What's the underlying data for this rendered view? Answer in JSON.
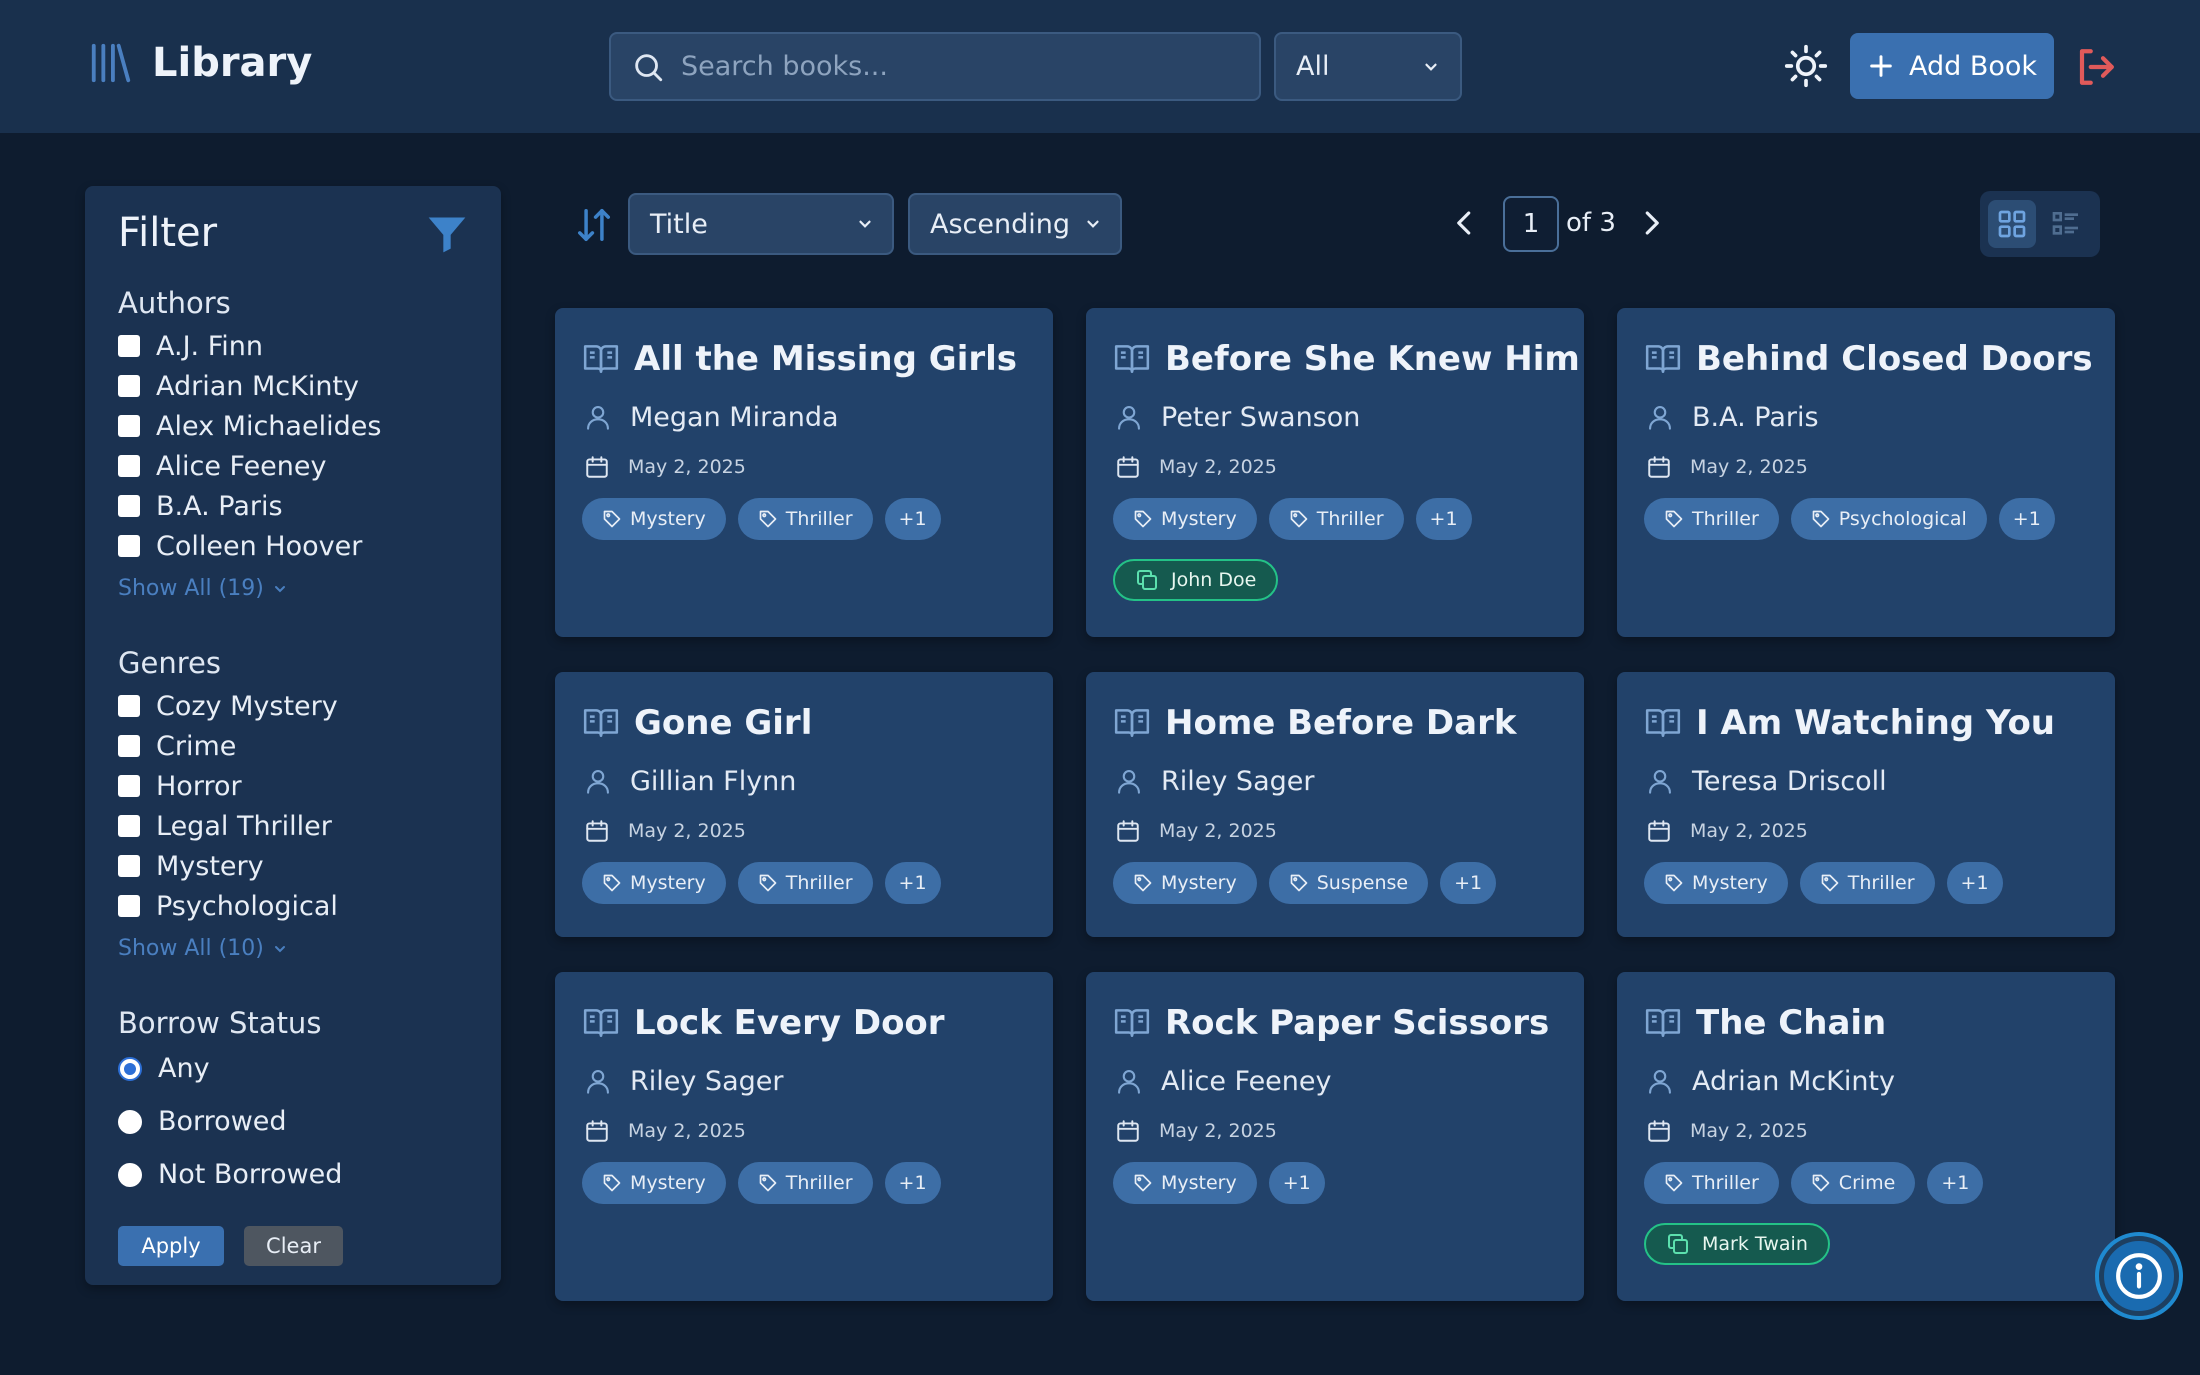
{
  "header": {
    "title": "Library",
    "search_placeholder": "Search books...",
    "scope": "All",
    "add_label": "Add Book"
  },
  "toolbar": {
    "sort_field": "Title",
    "sort_order": "Ascending",
    "page": "1",
    "of_label": "of 3"
  },
  "sidebar": {
    "title": "Filter",
    "authors_title": "Authors",
    "authors": [
      "A.J. Finn",
      "Adrian McKinty",
      "Alex Michaelides",
      "Alice Feeney",
      "B.A. Paris",
      "Colleen Hoover"
    ],
    "authors_show_all": "Show All (19)",
    "genres_title": "Genres",
    "genres": [
      "Cozy Mystery",
      "Crime",
      "Horror",
      "Legal Thriller",
      "Mystery",
      "Psychological"
    ],
    "genres_show_all": "Show All (10)",
    "borrow_title": "Borrow Status",
    "borrow_options": [
      "Any",
      "Borrowed",
      "Not Borrowed"
    ],
    "apply_label": "Apply",
    "clear_label": "Clear"
  },
  "books": [
    {
      "title": "All the Missing Girls",
      "author": "Megan Miranda",
      "date": "May 2, 2025",
      "tags": [
        "Mystery",
        "Thriller"
      ],
      "more": "+1",
      "borrower": ""
    },
    {
      "title": "Before She Knew Him",
      "author": "Peter Swanson",
      "date": "May 2, 2025",
      "tags": [
        "Mystery",
        "Thriller"
      ],
      "more": "+1",
      "borrower": "John Doe"
    },
    {
      "title": "Behind Closed Doors",
      "author": "B.A. Paris",
      "date": "May 2, 2025",
      "tags": [
        "Thriller",
        "Psychological"
      ],
      "more": "+1",
      "borrower": ""
    },
    {
      "title": "Gone Girl",
      "author": "Gillian Flynn",
      "date": "May 2, 2025",
      "tags": [
        "Mystery",
        "Thriller"
      ],
      "more": "+1",
      "borrower": ""
    },
    {
      "title": "Home Before Dark",
      "author": "Riley Sager",
      "date": "May 2, 2025",
      "tags": [
        "Mystery",
        "Suspense"
      ],
      "more": "+1",
      "borrower": ""
    },
    {
      "title": "I Am Watching You",
      "author": "Teresa Driscoll",
      "date": "May 2, 2025",
      "tags": [
        "Mystery",
        "Thriller"
      ],
      "more": "+1",
      "borrower": ""
    },
    {
      "title": "Lock Every Door",
      "author": "Riley Sager",
      "date": "May 2, 2025",
      "tags": [
        "Mystery",
        "Thriller"
      ],
      "more": "+1",
      "borrower": ""
    },
    {
      "title": "Rock Paper Scissors",
      "author": "Alice Feeney",
      "date": "May 2, 2025",
      "tags": [
        "Mystery"
      ],
      "more": "+1",
      "borrower": ""
    },
    {
      "title": "The Chain",
      "author": "Adrian McKinty",
      "date": "May 2, 2025",
      "tags": [
        "Thriller",
        "Crime"
      ],
      "more": "+1",
      "borrower": "Mark Twain"
    }
  ],
  "icons": {
    "brand": "library-icon",
    "search": "search-icon",
    "theme": "sun-icon",
    "add": "plus-icon",
    "logout": "logout-icon",
    "filter": "funnel-icon",
    "sort": "sort-icon",
    "book": "book-open-icon",
    "author": "user-icon",
    "date": "calendar-icon",
    "tag": "tag-icon",
    "borrower": "copy-icon",
    "info": "info-icon"
  },
  "colors": {
    "accent": "#3a70b0",
    "logout": "#e05a5a",
    "borrowed": "#24c287"
  }
}
